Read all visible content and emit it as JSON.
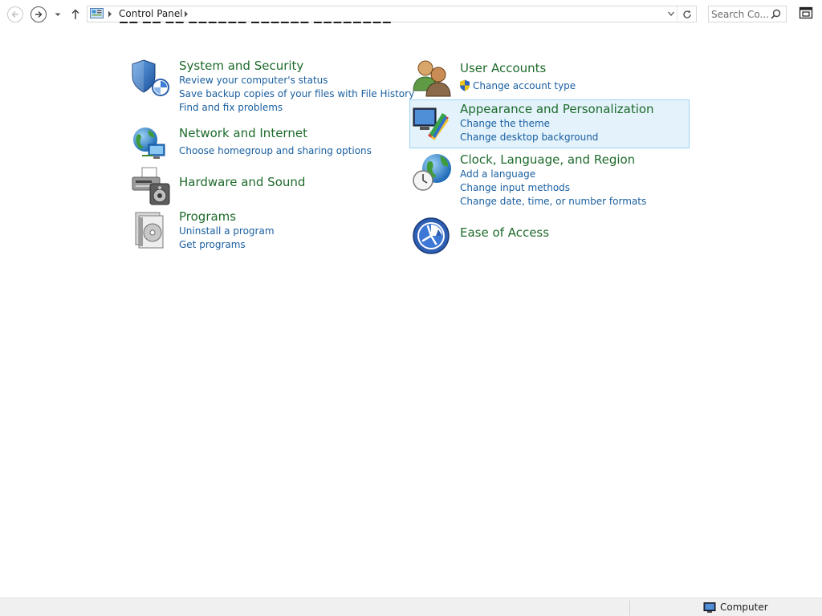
{
  "address_bar": {
    "breadcrumbs": [
      "Control Panel"
    ]
  },
  "search": {
    "placeholder": "Search Co..."
  },
  "categories_left": [
    {
      "title": "System and Security",
      "links": [
        "Review your computer's status",
        "Save backup copies of your files with File History",
        "Find and fix problems"
      ]
    },
    {
      "title": "Network and Internet",
      "links": [
        "Choose homegroup and sharing options"
      ]
    },
    {
      "title": "Hardware and Sound",
      "links": []
    },
    {
      "title": "Programs",
      "links": [
        "Uninstall a program",
        "Get programs"
      ]
    }
  ],
  "categories_right": [
    {
      "title": "User Accounts",
      "links": [
        "Change account type"
      ]
    },
    {
      "title": "Appearance and Personalization",
      "links": [
        "Change the theme",
        "Change desktop background"
      ]
    },
    {
      "title": "Clock, Language, and Region",
      "links": [
        "Add a language",
        "Change input methods",
        "Change date, time, or number formats"
      ]
    },
    {
      "title": "Ease of Access",
      "links": []
    }
  ],
  "status_bar": {
    "location_label": "Computer"
  },
  "colors": {
    "category_title": "#1e6b2b",
    "link": "#1a5fa0",
    "highlight_fill": "#e3f2fb",
    "highlight_border": "#9bd2f0"
  }
}
